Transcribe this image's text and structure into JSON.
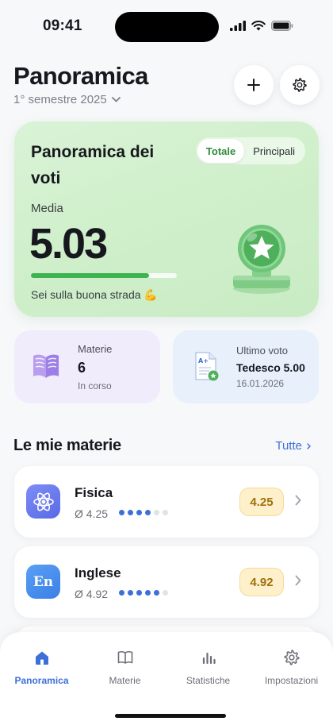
{
  "status_bar": {
    "time": "09:41"
  },
  "header": {
    "title": "Panoramica",
    "semester": "1° semestre 2025",
    "add_icon": "plus-icon",
    "settings_icon": "gear-icon"
  },
  "grades_card": {
    "title": "Panoramica dei voti",
    "segments": [
      "Totale",
      "Principali"
    ],
    "active_segment": "Totale",
    "average_label": "Media",
    "average_value": "5.03",
    "progress_fraction": 0.81,
    "encouragement": "Sei sulla buona strada 💪",
    "accent_color": "#3fb34f"
  },
  "summary": {
    "subjects": {
      "label": "Materie",
      "count": "6",
      "sub": "In corso"
    },
    "last_grade": {
      "label": "Ultimo voto",
      "value": "Tedesco 5.00",
      "date": "16.01.2026"
    }
  },
  "subjects_section": {
    "title": "Le mie materie",
    "see_all": "Tutte",
    "items": [
      {
        "name": "Fisica",
        "avg": "Ø 4.25",
        "grade": "4.25",
        "dots_filled": 4,
        "dots_total": 6,
        "icon": "atom-icon"
      },
      {
        "name": "Inglese",
        "avg": "Ø 4.92",
        "grade": "4.92",
        "dots_filled": 5,
        "dots_total": 6,
        "icon": "en-icon",
        "icon_text": "En"
      }
    ]
  },
  "tab_bar": {
    "tabs": [
      {
        "label": "Panoramica",
        "icon": "home-icon"
      },
      {
        "label": "Materie",
        "icon": "book-icon"
      },
      {
        "label": "Statistiche",
        "icon": "chart-icon"
      },
      {
        "label": "Impostazioni",
        "icon": "gear-icon"
      }
    ],
    "active": "Panoramica",
    "accent_color": "#3d6fd8"
  }
}
